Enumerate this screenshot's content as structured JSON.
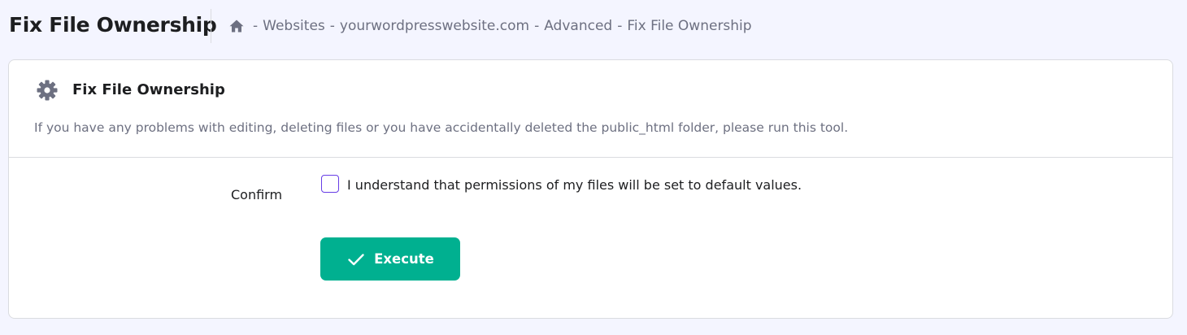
{
  "header": {
    "title": "Fix File Ownership",
    "breadcrumb": {
      "home_icon": "home-icon",
      "separator": "-",
      "items": [
        "Websites",
        "yourwordpresswebsite.com",
        "Advanced",
        "Fix File Ownership"
      ]
    }
  },
  "card": {
    "icon": "gear-icon",
    "title": "Fix File Ownership",
    "description": "If you have any problems with editing, deleting files or you have accidentally deleted the public_html folder, please run this tool.",
    "confirm_label": "Confirm",
    "checkbox": {
      "label": "I understand that permissions of my files will be set to default values.",
      "checked": false
    },
    "execute_button": {
      "label": "Execute",
      "icon": "check-icon"
    }
  },
  "colors": {
    "background": "#f4f5ff",
    "accent": "#673de6",
    "button": "#00b090",
    "muted_text": "#6d7081"
  }
}
